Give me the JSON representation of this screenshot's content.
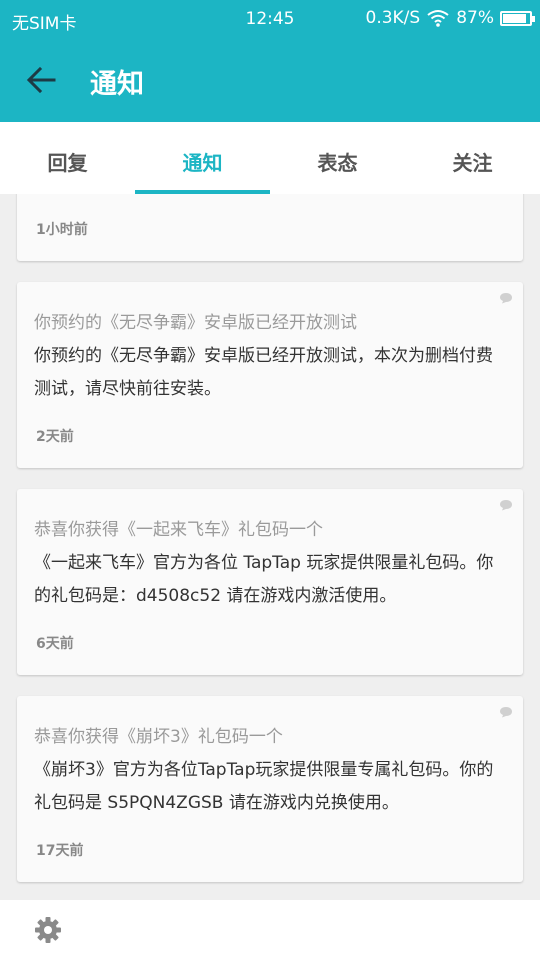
{
  "status_bar": {
    "carrier": "无SIM卡",
    "time": "12:45",
    "network_speed": "0.3K/S",
    "battery": "87%"
  },
  "app_bar": {
    "title": "通知"
  },
  "tabs": [
    {
      "label": "回复"
    },
    {
      "label": "通知"
    },
    {
      "label": "表态"
    },
    {
      "label": "关注"
    }
  ],
  "notifications": [
    {
      "time": "1小时前"
    },
    {
      "title": "你预约的《无尽争霸》安卓版已经开放测试",
      "body": "你预约的《无尽争霸》安卓版已经开放测试，本次为删档付费测试，请尽快前往安装。",
      "time": "2天前"
    },
    {
      "title": "恭喜你获得《一起来飞车》礼包码一个",
      "body": "《一起来飞车》官方为各位 TapTap 玩家提供限量礼包码。你的礼包码是：d4508c52 请在游戏内激活使用。",
      "time": "6天前"
    },
    {
      "title": "恭喜你获得《崩坏3》礼包码一个",
      "body": "《崩坏3》官方为各位TapTap玩家提供限量专属礼包码。你的礼包码是 S5PQN4ZGSB 请在游戏内兑换使用。",
      "time": "17天前"
    }
  ],
  "colors": {
    "accent": "#1cb5c4",
    "background": "#efefef",
    "card": "#fafafa"
  }
}
